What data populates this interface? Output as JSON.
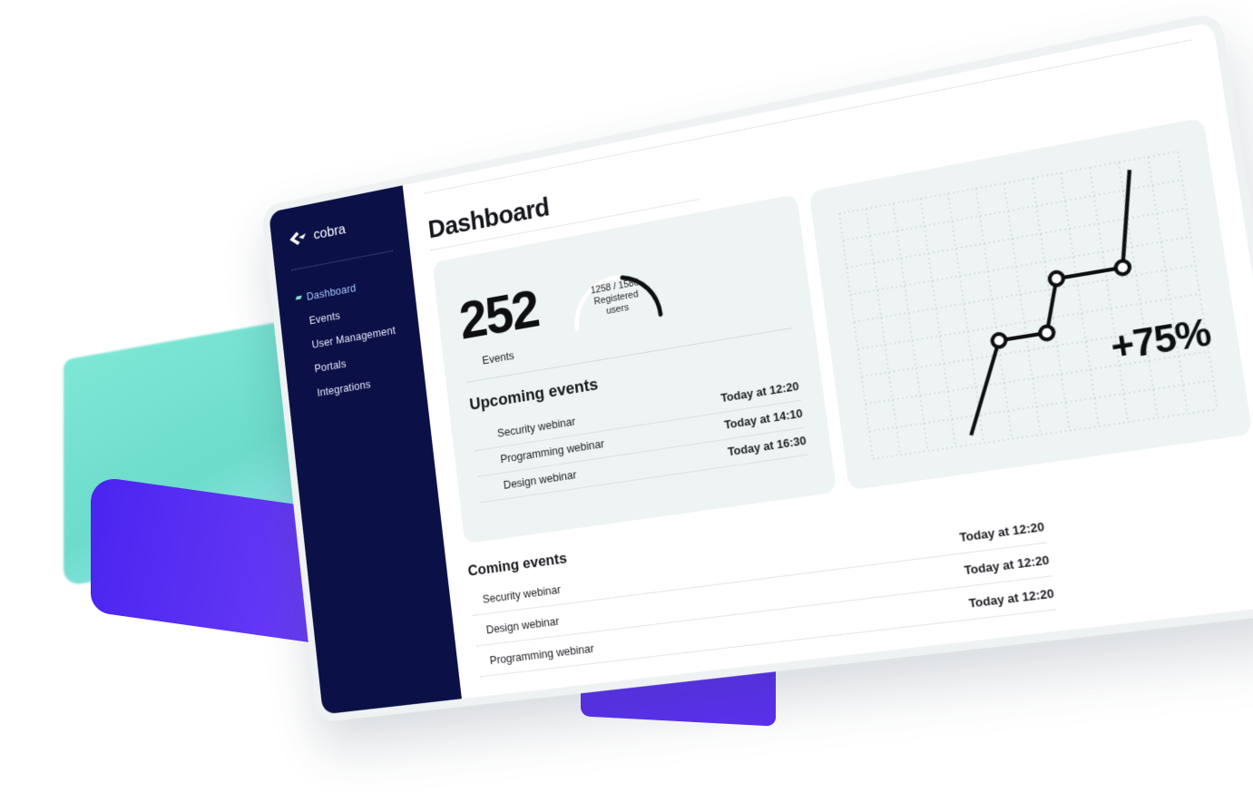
{
  "brand": {
    "name": "cobra"
  },
  "sidebar": {
    "items": [
      {
        "label": "Dashboard",
        "active": true
      },
      {
        "label": "Events",
        "active": false
      },
      {
        "label": "User Management",
        "active": false
      },
      {
        "label": "Portals",
        "active": false
      },
      {
        "label": "Integrations",
        "active": false
      }
    ]
  },
  "page": {
    "title": "Dashboard"
  },
  "stats": {
    "events_count": "252",
    "events_label": "Events",
    "registered_ratio": "1258 / 1586",
    "registered_label_1": "Registered",
    "registered_label_2": "users",
    "registered_fraction": 0.79
  },
  "upcoming": {
    "title": "Upcoming events",
    "rows": [
      {
        "name": "Security webinar",
        "time": "Today at 12:20"
      },
      {
        "name": "Programming webinar",
        "time": "Today at 14:10"
      },
      {
        "name": "Design webinar",
        "time": "Today at 16:30"
      }
    ]
  },
  "growth": {
    "label": "+75%"
  },
  "chart_data": {
    "type": "line",
    "title": "",
    "xlabel": "",
    "ylabel": "",
    "grid": true,
    "series": [
      {
        "values": [
          0,
          38,
          38,
          60,
          60,
          100
        ]
      }
    ],
    "markers_on": [
      1,
      2,
      3,
      4
    ]
  },
  "coming": {
    "title": "Coming events",
    "rows": [
      {
        "name": "Security webinar",
        "time": "Today at 12:20"
      },
      {
        "name": "Design webinar",
        "time": "Today at 12:20"
      },
      {
        "name": "Programming webinar",
        "time": "Today at 12:20"
      }
    ]
  },
  "colors": {
    "sidebar_bg": "#0b1147",
    "accent_teal": "#7fe4d2",
    "accent_purple": "#5b2ff2",
    "card_bg": "#eef4f3"
  }
}
